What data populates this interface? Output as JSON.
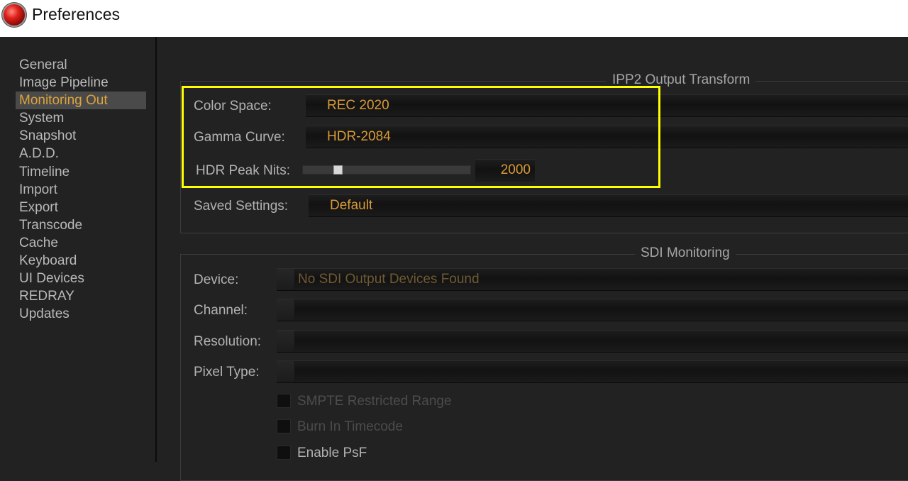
{
  "window": {
    "title": "Preferences"
  },
  "sidebar": {
    "items": [
      {
        "label": "General",
        "active": false
      },
      {
        "label": "Image Pipeline",
        "active": false
      },
      {
        "label": "Monitoring Out",
        "active": true
      },
      {
        "label": "System",
        "active": false
      },
      {
        "label": "Snapshot",
        "active": false
      },
      {
        "label": "A.D.D.",
        "active": false
      },
      {
        "label": "Timeline",
        "active": false
      },
      {
        "label": "Import",
        "active": false
      },
      {
        "label": "Export",
        "active": false
      },
      {
        "label": "Transcode",
        "active": false
      },
      {
        "label": "Cache",
        "active": false
      },
      {
        "label": "Keyboard",
        "active": false
      },
      {
        "label": "UI Devices",
        "active": false
      },
      {
        "label": "REDRAY",
        "active": false
      },
      {
        "label": "Updates",
        "active": false
      }
    ]
  },
  "ipp2": {
    "title": "IPP2 Output Transform",
    "color_space": {
      "label": "Color Space:",
      "value": "REC 2020"
    },
    "gamma_curve": {
      "label": "Gamma Curve:",
      "value": "HDR-2084"
    },
    "hdr_peak_nits": {
      "label": "HDR Peak Nits:",
      "value": "2000",
      "slider_fraction": 0.2
    },
    "saved_settings": {
      "label": "Saved Settings:",
      "value": "Default"
    }
  },
  "sdi": {
    "title": "SDI Monitoring",
    "device": {
      "label": "Device:",
      "value": "No SDI Output Devices Found"
    },
    "channel": {
      "label": "Channel:",
      "value": ""
    },
    "resolution": {
      "label": "Resolution:",
      "value": ""
    },
    "pixel_type": {
      "label": "Pixel Type:",
      "value": ""
    },
    "smpte": {
      "label": "SMPTE Restricted Range",
      "checked": false,
      "enabled": false
    },
    "burn_timecode": {
      "label": "Burn In Timecode",
      "checked": false,
      "enabled": false
    },
    "enable_psf": {
      "label": "Enable PsF",
      "checked": false,
      "enabled": true
    }
  },
  "colors": {
    "accent": "#dca33c",
    "highlight": "#ffff00",
    "background": "#222222"
  }
}
